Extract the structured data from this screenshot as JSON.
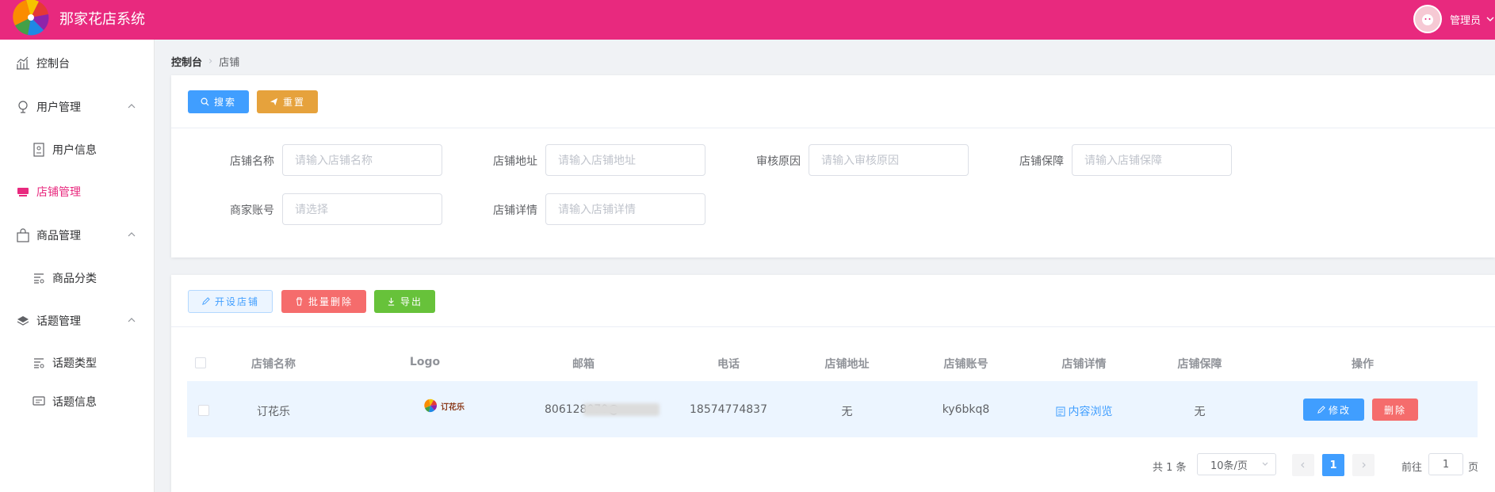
{
  "header": {
    "title": "那家花店系统",
    "user_name": "管理员"
  },
  "sidebar": {
    "items": [
      {
        "label": "控制台",
        "icon": "chart-icon"
      },
      {
        "label": "用户管理",
        "icon": "user-icon"
      },
      {
        "label": "用户信息",
        "icon": "id-card-icon"
      },
      {
        "label": "店铺管理",
        "icon": "store-icon"
      },
      {
        "label": "商品管理",
        "icon": "bag-icon"
      },
      {
        "label": "商品分类",
        "icon": "list-icon"
      },
      {
        "label": "话题管理",
        "icon": "layers-icon"
      },
      {
        "label": "话题类型",
        "icon": "list-icon"
      },
      {
        "label": "话题信息",
        "icon": "message-icon"
      }
    ]
  },
  "breadcrumb": {
    "first": "控制台",
    "current": "店铺"
  },
  "search": {
    "search_btn": "搜索",
    "reset_btn": "重置",
    "fields": [
      {
        "label": "店铺名称",
        "placeholder": "请输入店铺名称"
      },
      {
        "label": "店铺地址",
        "placeholder": "请输入店铺地址"
      },
      {
        "label": "审核原因",
        "placeholder": "请输入审核原因"
      },
      {
        "label": "店铺保障",
        "placeholder": "请输入店铺保障"
      },
      {
        "label": "商家账号",
        "placeholder": "请选择"
      },
      {
        "label": "店铺详情",
        "placeholder": "请输入店铺详情"
      }
    ]
  },
  "toolbar": {
    "open_store": "开设店铺",
    "batch_delete": "批量删除",
    "export": "导出"
  },
  "table": {
    "headers": [
      "店铺名称",
      "Logo",
      "邮箱",
      "电话",
      "店铺地址",
      "店铺账号",
      "店铺详情",
      "店铺保障",
      "操作"
    ],
    "rows": [
      {
        "name": "订花乐",
        "logo_text": "订花乐",
        "email": "806128070@",
        "phone": "18574774837",
        "address": "无",
        "account": "ky6bkq8",
        "detail": "内容浏览",
        "guarantee": "无",
        "edit": "修改",
        "delete": "删除"
      }
    ]
  },
  "pagination": {
    "total": "共 1 条",
    "page_size": "10条/页",
    "current_page": "1",
    "goto_label": "前往",
    "goto_value": "1",
    "goto_unit": "页"
  },
  "colors": {
    "brand": "#e8297e",
    "primary": "#409eff",
    "warning": "#e6a23c",
    "danger": "#f56c6c",
    "success": "#67c23a"
  }
}
